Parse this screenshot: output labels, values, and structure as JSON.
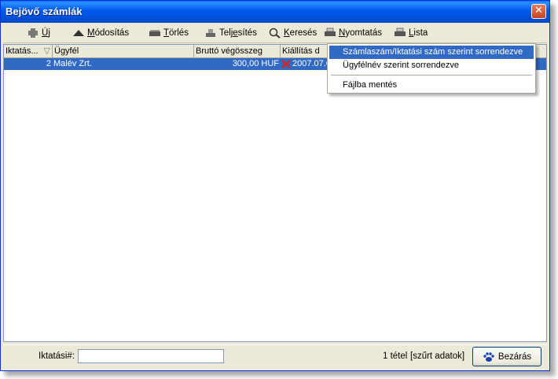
{
  "window": {
    "title": "Bejövő számlák",
    "close_label": "✕"
  },
  "toolbar": {
    "new": {
      "pre": "",
      "ul": "Ú",
      "post": "j"
    },
    "edit": {
      "pre": "",
      "ul": "M",
      "post": "ódosítás"
    },
    "delete": {
      "pre": "",
      "ul": "T",
      "post": "örlés"
    },
    "fulfill": {
      "pre": "Telj",
      "ul": "e",
      "post": "sítés"
    },
    "search": {
      "pre": "",
      "ul": "K",
      "post": "eresés"
    },
    "print": {
      "pre": "",
      "ul": "N",
      "post": "yomtatás"
    },
    "list": {
      "pre": "",
      "ul": "L",
      "post": "ista"
    }
  },
  "grid": {
    "headers": [
      "Iktatás...",
      "Ügyfél",
      "Bruttó végösszeg",
      "Kiállítás d"
    ],
    "sort_glyph": "▽",
    "rows": [
      {
        "id": "2",
        "client": "Malév Zrt.",
        "gross": "300,00 HUF",
        "date": "2007.07.0"
      }
    ]
  },
  "menu": {
    "items": [
      "Számlaszám/Iktatási szám szerint sorrendezve",
      "Ügyfélnév szerint sorrendezve",
      "Fájlba mentés"
    ]
  },
  "status": {
    "filter_label": "Iktatási#:",
    "filter_value": "",
    "count": "1 tétel",
    "filtered": "[szűrt adatok]",
    "close_button": "Bezárás"
  }
}
